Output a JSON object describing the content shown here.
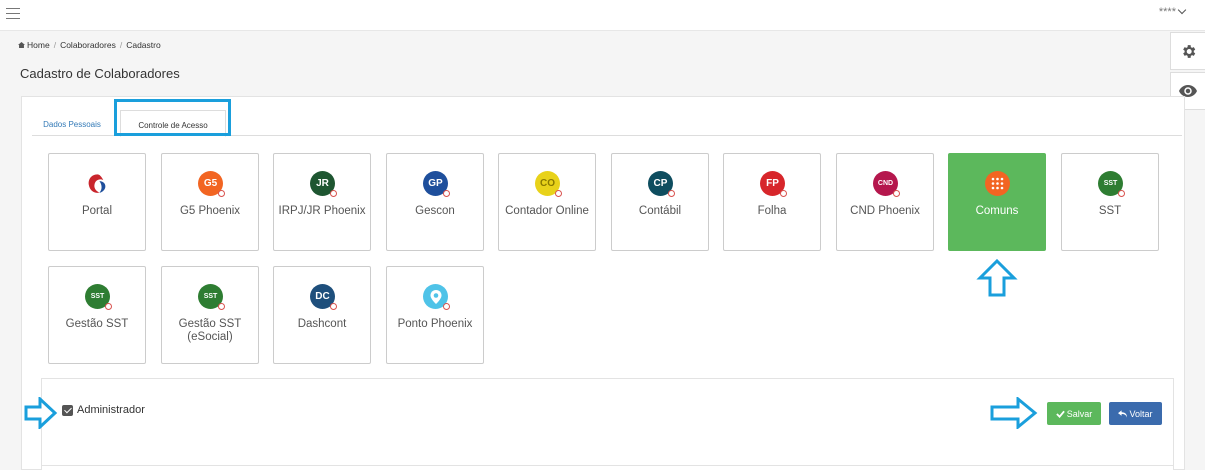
{
  "header": {
    "user_label": "****"
  },
  "breadcrumb": {
    "home": "Home",
    "level1": "Colaboradores",
    "level2": "Cadastro"
  },
  "page": {
    "title": "Cadastro de Colaboradores"
  },
  "tabs": [
    {
      "label": "Dados Pessoais",
      "active": false
    },
    {
      "label": "Controle de Acesso",
      "active": true
    }
  ],
  "modules": [
    {
      "label": "Portal",
      "logo": "portal-logo-icon",
      "logo_text": "",
      "color": "#c9252c"
    },
    {
      "label": "G5 Phoenix",
      "logo": "g5-logo-icon",
      "logo_text": "G5",
      "color": "#f26522"
    },
    {
      "label": "IRPJ/JR Phoenix",
      "logo": "jr-logo-icon",
      "logo_text": "JR",
      "color": "#1e5631"
    },
    {
      "label": "Gescon",
      "logo": "gp-logo-icon",
      "logo_text": "GP",
      "color": "#1e4f9c"
    },
    {
      "label": "Contador Online",
      "logo": "co-logo-icon",
      "logo_text": "CO",
      "color": "#e8d21a"
    },
    {
      "label": "Contábil",
      "logo": "cp-logo-icon",
      "logo_text": "CP",
      "color": "#0e4d5f"
    },
    {
      "label": "Folha",
      "logo": "fp-logo-icon",
      "logo_text": "FP",
      "color": "#d7262b"
    },
    {
      "label": "CND Phoenix",
      "logo": "cnd-logo-icon",
      "logo_text": "CND",
      "color": "#b5174d"
    },
    {
      "label": "Comuns",
      "logo": "grid-dots-icon",
      "logo_text": "",
      "color": "#f26522",
      "selected": true
    },
    {
      "label": "SST",
      "logo": "sst-logo-icon",
      "logo_text": "SST",
      "color": "#2e7d32"
    },
    {
      "label": "Gestão SST",
      "logo": "sst-logo-icon",
      "logo_text": "SST",
      "color": "#2e7d32"
    },
    {
      "label": "Gestão SST (eSocial)",
      "logo": "sst-logo-icon",
      "logo_text": "SST",
      "color": "#2e7d32"
    },
    {
      "label": "Dashcont",
      "logo": "dc-logo-icon",
      "logo_text": "DC",
      "color": "#1e4f7c"
    },
    {
      "label": "Ponto Phoenix",
      "logo": "ponto-logo-icon",
      "logo_text": "",
      "color": "#4fc3e8"
    }
  ],
  "form": {
    "admin_label": "Administrador",
    "admin_checked": true,
    "save_label": "Salvar",
    "back_label": "Voltar"
  },
  "colors": {
    "accent_blue": "#1a9fdc",
    "success": "#5cb85c",
    "primary": "#3b6bad"
  }
}
